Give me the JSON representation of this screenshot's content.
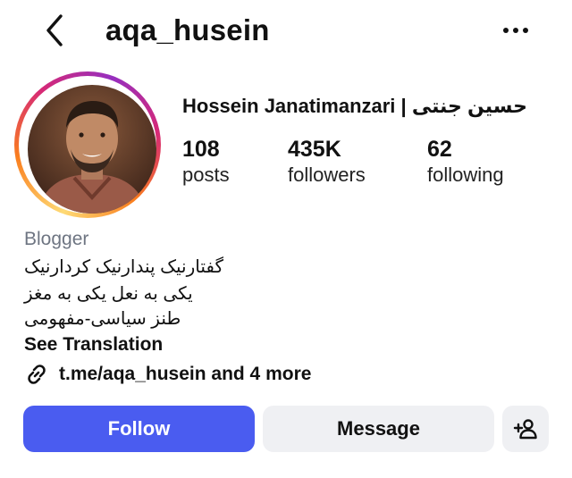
{
  "header": {
    "username": "aqa_husein"
  },
  "profile": {
    "full_name": "Hossein Janatimanzari | حسین جنتی",
    "stats": [
      {
        "value": "108",
        "label": "posts"
      },
      {
        "value": "435K",
        "label": "followers"
      },
      {
        "value": "62",
        "label": "following"
      }
    ],
    "category": "Blogger",
    "bio_lines": [
      "گفتارنیک پندارنیک کردارنیک",
      "یکی به نعل یکی به مغز",
      "طنز سیاسی-مفهومی"
    ],
    "see_translation": "See Translation",
    "link_text": "t.me/aqa_husein and 4 more"
  },
  "actions": {
    "follow_label": "Follow",
    "message_label": "Message"
  },
  "icons": {
    "back": "chevron-left-icon",
    "more": "more-horizontal-icon",
    "link": "link-icon",
    "add_user": "add-user-icon"
  },
  "colors": {
    "follow_button": "#4a5cf0",
    "secondary_button": "#eff0f3",
    "category_text": "#6e7582",
    "story_ring_start": "#feda75",
    "story_ring_end": "#962fbf"
  }
}
